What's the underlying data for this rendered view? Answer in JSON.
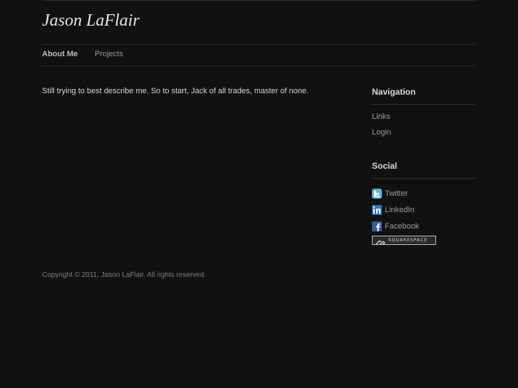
{
  "site": {
    "title": "Jason LaFlair"
  },
  "main_nav": [
    {
      "label": "About Me",
      "active": true
    },
    {
      "label": "Projects",
      "active": false
    }
  ],
  "content": {
    "body": "Still trying to best describe me. So to start, Jack of all trades, master of none."
  },
  "sidebar": {
    "navigation": {
      "heading": "Navigation",
      "items": [
        {
          "label": "Links"
        },
        {
          "label": "Login"
        }
      ]
    },
    "social": {
      "heading": "Social",
      "items": [
        {
          "label": "Twitter",
          "icon": "twitter-icon"
        },
        {
          "label": "LinkedIn",
          "icon": "linkedin-icon"
        },
        {
          "label": "Facebook",
          "icon": "facebook-icon"
        }
      ],
      "badge_text": "SQUARESPACE"
    }
  },
  "footer": {
    "copyright": "Copyright © 2011, Jason LaFlair. All rights reserved."
  },
  "colors": {
    "background": "#111111",
    "twitter": "#5fb3d9",
    "linkedin": "#2b77b8",
    "facebook": "#3b5998"
  }
}
